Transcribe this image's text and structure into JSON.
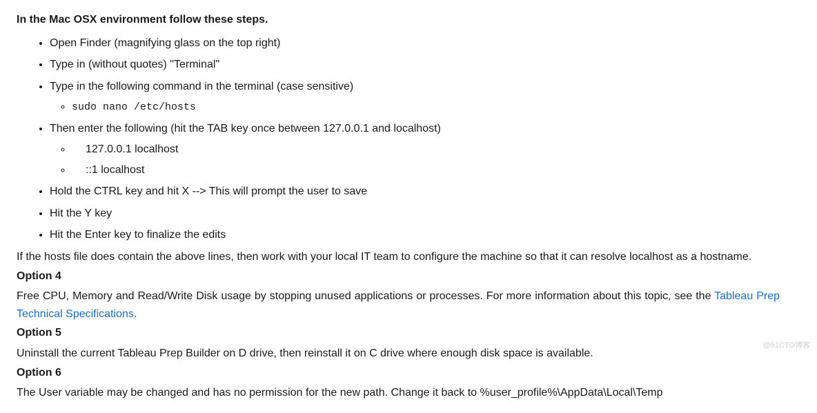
{
  "heading": "In the Mac OSX environment follow these steps.",
  "steps": {
    "s1": "Open Finder (magnifying glass on the top right)",
    "s2": "Type in (without quotes) \"Terminal\"",
    "s3": "Type in the following command in the terminal (case sensitive)",
    "s3_cmd": "sudo nano /etc/hosts",
    "s4": "Then enter the following (hit the TAB key once between 127.0.0.1 and localhost)",
    "s4_entry1": "   127.0.0.1    localhost",
    "s4_entry2": "   ::1               localhost",
    "s5": "Hold the CTRL key and hit X --> This will prompt the user to save",
    "s6": "Hit the Y key",
    "s7": "Hit the Enter key to finalize the edits"
  },
  "after_steps": "If the hosts file does contain the above lines, then work with your local IT team to configure the machine so that it can resolve localhost as a hostname.",
  "option4": {
    "title": "Option 4",
    "text_before": "Free CPU, Memory and Read/Write Disk usage by stopping unused applications or processes. For more information about this topic, see the ",
    "link": "Tableau Prep Technical Specifications",
    "text_after": "."
  },
  "option5": {
    "title": "Option 5",
    "text": "Uninstall the current Tableau Prep Builder on D drive, then reinstall it on C drive where enough disk space is available."
  },
  "option6": {
    "title": "Option 6",
    "text": "The User variable may be changed and has no permission for the new path. Change it back to %user_profile%\\AppData\\Local\\Temp"
  },
  "watermark": "@51CTO博客"
}
